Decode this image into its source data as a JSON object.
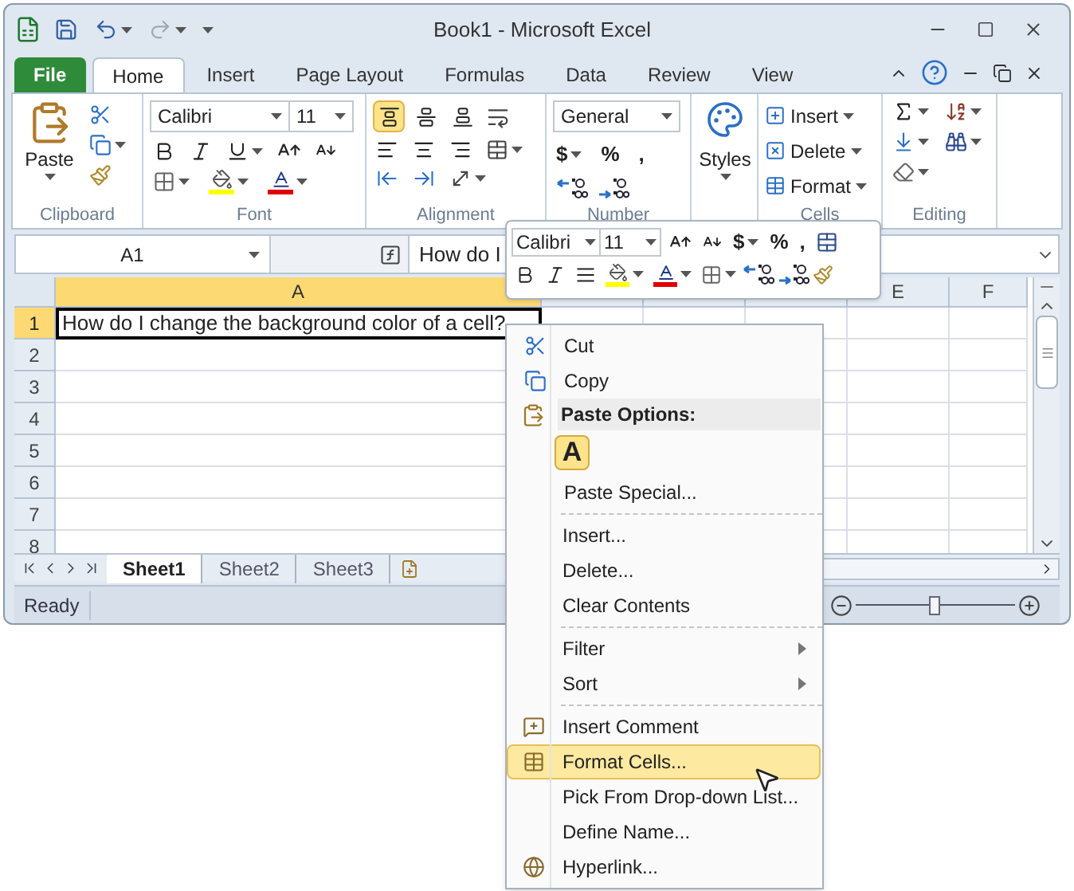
{
  "window": {
    "title": "Book1 - Microsoft Excel"
  },
  "ribbon_tabs": [
    {
      "label": "File",
      "kind": "file",
      "selected": false
    },
    {
      "label": "Home",
      "kind": "tab",
      "selected": true
    },
    {
      "label": "Insert",
      "kind": "tab",
      "selected": false
    },
    {
      "label": "Page Layout",
      "kind": "tab",
      "selected": false
    },
    {
      "label": "Formulas",
      "kind": "tab",
      "selected": false
    },
    {
      "label": "Data",
      "kind": "tab",
      "selected": false
    },
    {
      "label": "Review",
      "kind": "tab",
      "selected": false
    },
    {
      "label": "View",
      "kind": "tab",
      "selected": false
    }
  ],
  "ribbon": {
    "clipboard": {
      "paste_label": "Paste",
      "group_label": "Clipboard"
    },
    "font": {
      "font_name": "Calibri",
      "font_size": "11",
      "group_label": "Font"
    },
    "alignment": {
      "vertical_buttons": [
        {
          "selected": true
        },
        {
          "selected": false
        },
        {
          "selected": false
        }
      ],
      "group_label": "Alignment"
    },
    "number": {
      "format": "General",
      "currency": "$",
      "percent": "%",
      "comma": ",",
      "group_label": "Number"
    },
    "styles": {
      "label": "Styles"
    },
    "cells": {
      "buttons": [
        "Insert",
        "Delete",
        "Format"
      ],
      "group_label": "Cells"
    },
    "editing": {
      "group_label": "Editing"
    }
  },
  "formula_bar": {
    "name_box": "A1",
    "value": "How do I"
  },
  "mini_toolbar": {
    "font_name": "Calibri",
    "font_size": "11",
    "currency": "$",
    "percent": "%",
    "comma": ","
  },
  "sheet": {
    "columns": [
      {
        "label": "A",
        "selected": true
      },
      {
        "label": "E",
        "selected": false
      },
      {
        "label": "F",
        "selected": false
      }
    ],
    "rows": [
      {
        "label": "1",
        "selected": true,
        "cells": [
          "How do I change the background color of a cell?"
        ]
      },
      {
        "label": "2",
        "selected": false
      },
      {
        "label": "3",
        "selected": false
      },
      {
        "label": "4",
        "selected": false
      },
      {
        "label": "5",
        "selected": false
      },
      {
        "label": "6",
        "selected": false
      },
      {
        "label": "7",
        "selected": false
      },
      {
        "label": "8",
        "selected": false
      }
    ]
  },
  "sheet_tabs": [
    {
      "label": "Sheet1",
      "selected": true
    },
    {
      "label": "Sheet2",
      "selected": false
    },
    {
      "label": "Sheet3",
      "selected": false
    }
  ],
  "status_bar": {
    "text": "Ready",
    "zoom": {
      "level": 0.5
    }
  },
  "context_menu": {
    "sections": [
      {
        "items": [
          {
            "kind": "command",
            "label": "Cut",
            "selected": false,
            "submenu": false
          },
          {
            "kind": "command",
            "label": "Copy",
            "selected": false,
            "submenu": false
          },
          {
            "kind": "heading",
            "label": "Paste Options:"
          },
          {
            "kind": "paste_option",
            "label": "A"
          },
          {
            "kind": "command",
            "label": "Paste Special...",
            "selected": false,
            "submenu": false
          }
        ]
      },
      {
        "items": [
          {
            "kind": "command",
            "label": "Insert...",
            "selected": false,
            "submenu": false
          },
          {
            "kind": "command",
            "label": "Delete...",
            "selected": false,
            "submenu": false
          },
          {
            "kind": "command",
            "label": "Clear Contents",
            "selected": false,
            "submenu": false
          }
        ]
      },
      {
        "items": [
          {
            "kind": "command",
            "label": "Filter",
            "selected": false,
            "submenu": true
          },
          {
            "kind": "command",
            "label": "Sort",
            "selected": false,
            "submenu": true
          }
        ]
      },
      {
        "items": [
          {
            "kind": "command",
            "label": "Insert Comment",
            "selected": false,
            "submenu": false
          },
          {
            "kind": "command",
            "label": "Format Cells...",
            "selected": true,
            "submenu": false
          },
          {
            "kind": "command",
            "label": "Pick From Drop-down List...",
            "selected": false,
            "submenu": false
          },
          {
            "kind": "command",
            "label": "Define Name...",
            "selected": false,
            "submenu": false
          },
          {
            "kind": "command",
            "label": "Hyperlink...",
            "selected": false,
            "submenu": false
          }
        ]
      }
    ]
  }
}
